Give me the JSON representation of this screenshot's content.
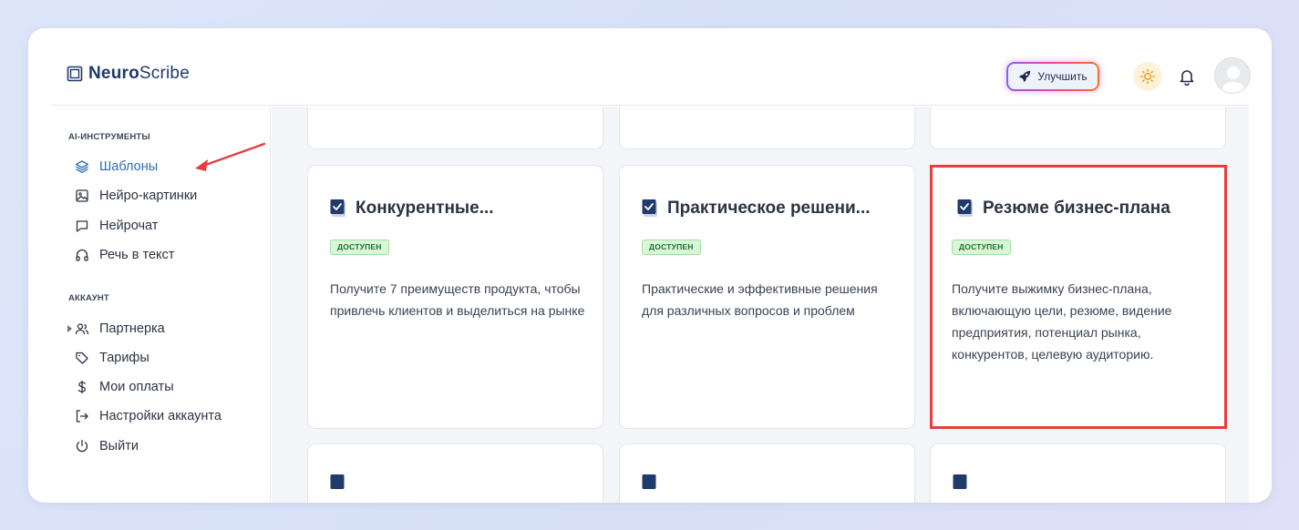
{
  "app": {
    "logo_bold": "Neuro",
    "logo_light": "Scribe"
  },
  "header": {
    "upgrade_label": "Улучшить"
  },
  "sidebar": {
    "section_ai": "AI-ИНСТРУМЕНТЫ",
    "ai_items": [
      {
        "label": "Шаблоны",
        "icon": "layers-icon",
        "active": true
      },
      {
        "label": "Нейро-картинки",
        "icon": "image-icon"
      },
      {
        "label": "Нейрочат",
        "icon": "chat-icon"
      },
      {
        "label": "Речь в текст",
        "icon": "headphones-icon"
      }
    ],
    "section_account": "АККАУНТ",
    "account_items": [
      {
        "label": "Партнерка",
        "icon": "users-icon"
      },
      {
        "label": "Тарифы",
        "icon": "tag-icon"
      },
      {
        "label": "Мои оплаты",
        "icon": "dollar-icon"
      },
      {
        "label": "Настройки аккаунта",
        "icon": "logout-arrow-icon"
      },
      {
        "label": "Выйти",
        "icon": "power-icon"
      }
    ]
  },
  "cards": [
    {
      "title": "Конкурентные...",
      "badge": "ДОСТУПЕН",
      "description": "Получите 7 преимуществ продукта, чтобы привлечь клиентов и выделиться на рынке"
    },
    {
      "title": "Практическое решени...",
      "badge": "ДОСТУПЕН",
      "description": "Практические и эффективные решения для различных вопросов и проблем"
    },
    {
      "title": "Резюме бизнес-плана",
      "badge": "ДОСТУПЕН",
      "description": "Получите выжимку бизнес-плана, включающую цели, резюме, видение предприятия, потенциал рынка, конкурентов, целевую аудиторию."
    }
  ],
  "colors": {
    "accent": "#2f6fb3",
    "highlight": "#e53e3e",
    "badge_bg": "#d9f6d8"
  }
}
